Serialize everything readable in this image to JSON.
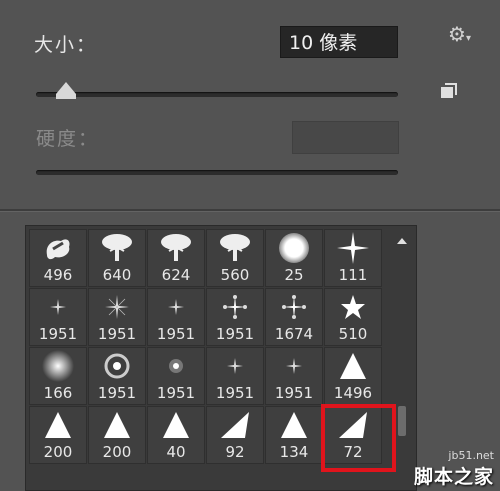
{
  "size": {
    "label": "大小：",
    "value": "10 像素",
    "slider_fraction": 0.08
  },
  "hardness": {
    "label": "硬度：",
    "value": ""
  },
  "icons": {
    "settings": "gear-icon",
    "new_preset": "new-preset-icon"
  },
  "brushes": [
    {
      "size": "496",
      "shape": "splash"
    },
    {
      "size": "640",
      "shape": "tree"
    },
    {
      "size": "624",
      "shape": "tree"
    },
    {
      "size": "560",
      "shape": "tree"
    },
    {
      "size": "25",
      "shape": "soft-round"
    },
    {
      "size": "111",
      "shape": "star-sparkle"
    },
    {
      "size": "1951",
      "shape": "sparkle-small"
    },
    {
      "size": "1951",
      "shape": "sparkle"
    },
    {
      "size": "1951",
      "shape": "sparkle-small"
    },
    {
      "size": "1951",
      "shape": "sparkle-burst"
    },
    {
      "size": "1674",
      "shape": "sparkle-burst"
    },
    {
      "size": "510",
      "shape": "star"
    },
    {
      "size": "166",
      "shape": "soft-blur"
    },
    {
      "size": "1951",
      "shape": "ring"
    },
    {
      "size": "1951",
      "shape": "dot-glow"
    },
    {
      "size": "1951",
      "shape": "sparkle-small"
    },
    {
      "size": "1951",
      "shape": "sparkle-small"
    },
    {
      "size": "1496",
      "shape": "triangle"
    },
    {
      "size": "200",
      "shape": "triangle"
    },
    {
      "size": "200",
      "shape": "triangle"
    },
    {
      "size": "40",
      "shape": "triangle"
    },
    {
      "size": "92",
      "shape": "shard"
    },
    {
      "size": "134",
      "shape": "triangle"
    },
    {
      "size": "72",
      "shape": "shard"
    }
  ],
  "selected_index": 23,
  "accent_color": "#e0141c",
  "watermark": {
    "url": "jb51.net",
    "name": "脚本之家"
  }
}
